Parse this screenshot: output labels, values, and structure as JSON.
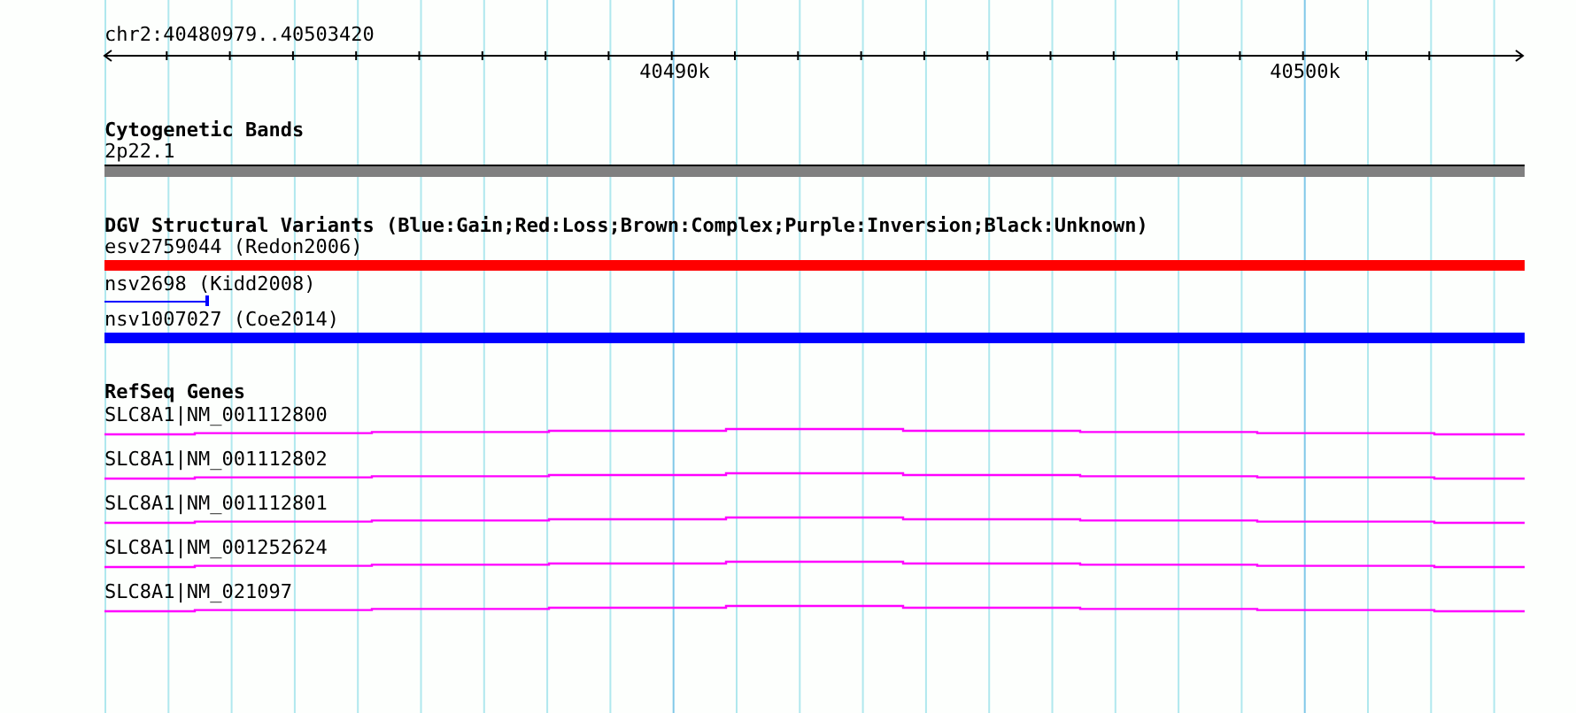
{
  "ruler": {
    "location": "chr2:40480979..40503420",
    "ticks": [
      {
        "label": "40490k"
      },
      {
        "label": "40500k"
      }
    ]
  },
  "tracks": [
    {
      "kind": "bands",
      "title": "Cytogenetic Bands",
      "features": [
        {
          "label": "2p22.1",
          "kind": "band"
        }
      ]
    },
    {
      "kind": "variants",
      "title": "DGV Structural Variants (Blue:Gain;Red:Loss;Brown:Complex;Purple:Inversion;Black:Unknown)",
      "features": [
        {
          "label": "esv2759044 (Redon2006)",
          "kind": "bar",
          "color": "#ff0000"
        },
        {
          "label": "nsv2698 (Kidd2008)",
          "kind": "segment",
          "color": "#0000ff"
        },
        {
          "label": "nsv1007027 (Coe2014)",
          "kind": "bar",
          "color": "#0000ff"
        }
      ]
    },
    {
      "kind": "genes",
      "title": "RefSeq Genes",
      "features": [
        {
          "label": "SLC8A1|NM_001112800",
          "kind": "gene"
        },
        {
          "label": "SLC8A1|NM_001112802",
          "kind": "gene"
        },
        {
          "label": "SLC8A1|NM_001112801",
          "kind": "gene"
        },
        {
          "label": "SLC8A1|NM_001252624",
          "kind": "gene"
        },
        {
          "label": "SLC8A1|NM_021097",
          "kind": "gene"
        }
      ]
    }
  ]
}
